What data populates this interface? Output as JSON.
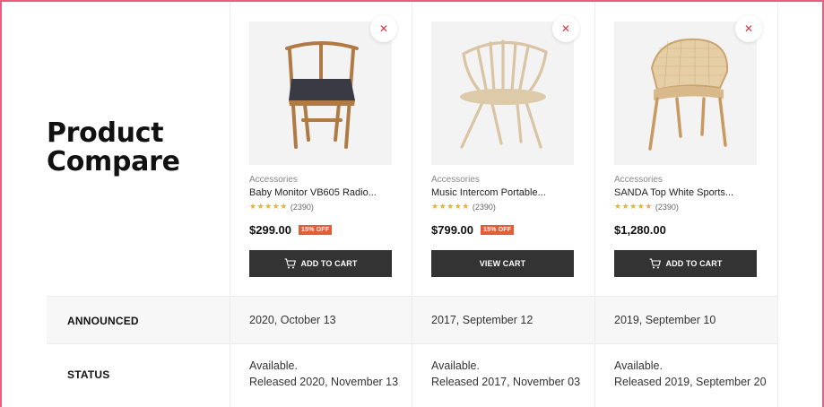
{
  "page": {
    "title_line1": "Product",
    "title_line2": "Compare"
  },
  "products": [
    {
      "category": "Accessories",
      "name": "Baby Monitor VB605 Radio...",
      "review_count": "(2390)",
      "stars": "★★★★★",
      "price": "$299.00",
      "discount": "15% OFF",
      "button_label": "ADD TO CART",
      "button_icon": "cart-icon",
      "remove_icon": "close-icon",
      "image": "chair-wishbone-black-seat"
    },
    {
      "category": "Accessories",
      "name": "Music Intercom Portable...",
      "review_count": "(2390)",
      "stars": "★★★★★",
      "price": "$799.00",
      "discount": "15% OFF",
      "button_label": "VIEW CART",
      "button_icon": "",
      "remove_icon": "close-icon",
      "image": "chair-spindle-back"
    },
    {
      "category": "Accessories",
      "name": "SANDA Top White Sports...",
      "review_count": "(2390)",
      "stars": "★★★★★",
      "price": "$1,280.00",
      "discount": "",
      "button_label": "ADD TO CART",
      "button_icon": "cart-icon",
      "remove_icon": "close-icon",
      "image": "chair-rattan-back"
    }
  ],
  "rows": [
    {
      "label": "ANNOUNCED",
      "values": [
        [
          "2020, October 13"
        ],
        [
          "2017, September 12"
        ],
        [
          "2019, September 10"
        ]
      ]
    },
    {
      "label": "STATUS",
      "values": [
        [
          "Available.",
          "Released 2020, November 13"
        ],
        [
          "Available.",
          "Released 2017, November 03"
        ],
        [
          "Available.",
          "Released 2019, September 20"
        ]
      ]
    }
  ],
  "colors": {
    "accent_frame": "#ec5c7f",
    "button_bg": "#333333",
    "badge_bg": "#e35d3a",
    "star": "#f2b01e",
    "remove_x": "#d9343d"
  }
}
